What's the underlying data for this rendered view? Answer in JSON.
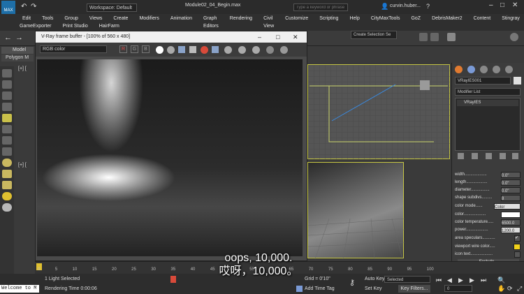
{
  "app": {
    "title": "Module02_04_Begin.max",
    "workspace": "Workspace: Default",
    "search_placeholder": "Type a keyword or phrase",
    "user": "curvin.huber..."
  },
  "menubar": {
    "items": [
      "Edit",
      "Tools",
      "Group",
      "Views",
      "Create",
      "Modifiers",
      "Animation",
      "Graph Editors",
      "Rendering",
      "Civil View",
      "Customize",
      "Scripting",
      "Help",
      "CityMaxTools",
      "GoZ",
      "DebrisMaker2",
      "Content",
      "Stingray"
    ],
    "items2": [
      "GameExporter",
      "Print Studio",
      "HairFarm"
    ]
  },
  "toolbar": {
    "create_selection": "Create Selection Se"
  },
  "left": {
    "model_tab": "Model",
    "polygon_tab": "Polygon M",
    "viewport_label1": "[+] [",
    "viewport_label2": "[+] ["
  },
  "vray_window": {
    "title": "V-Ray frame buffer - [100% of 560 x 480]",
    "channel": "RGB color",
    "channels": [
      "R",
      "G",
      "B"
    ]
  },
  "right_panel": {
    "object_name": "VRayIES001",
    "modifier_list": "Modifier List",
    "stack_item": "VRayIES",
    "params": [
      {
        "label": "width...................",
        "value": "0.0\""
      },
      {
        "label": "length..................",
        "value": "0.0\""
      },
      {
        "label": "diameter................",
        "value": "0.0\""
      },
      {
        "label": "shape subdivs.........",
        "value": "8"
      },
      {
        "label": "color mode......",
        "value": "Color"
      },
      {
        "label": "color...................",
        "value": ""
      },
      {
        "label": "color temperature.....",
        "value": "6500.0"
      },
      {
        "label": "power...................",
        "value": "1200.0"
      },
      {
        "label": "area speculars...........",
        "value": "✔"
      },
      {
        "label": "viewport wire color.....",
        "value": ""
      },
      {
        "label": "icon text...................",
        "value": ""
      }
    ],
    "exclude": "Exclude..."
  },
  "timeline": {
    "ticks": [
      "0",
      "5",
      "10",
      "15",
      "20",
      "25",
      "30",
      "35",
      "40",
      "45",
      "50",
      "55",
      "60",
      "65",
      "70",
      "75",
      "80",
      "85",
      "90",
      "95",
      "100"
    ]
  },
  "status": {
    "welcome": "Welcome to M",
    "selected": "1 Light Selected",
    "rendering_time": "Rendering Time  0:00:06",
    "grid": "Grid = 0'10\"",
    "add_time_tag": "Add Time Tag",
    "auto_key": "Auto Key",
    "set_key": "Set Key",
    "selected_dropdown": "Selected",
    "key_filters": "Key Filters...",
    "frame": "0"
  },
  "subtitle": {
    "line1": "oops, 10,000.",
    "line2": "哎呀，10,000。"
  },
  "colors": {
    "accent": "#c7c744",
    "swatch_yellow": "#f2d21b",
    "red_channel": "#e05050"
  }
}
